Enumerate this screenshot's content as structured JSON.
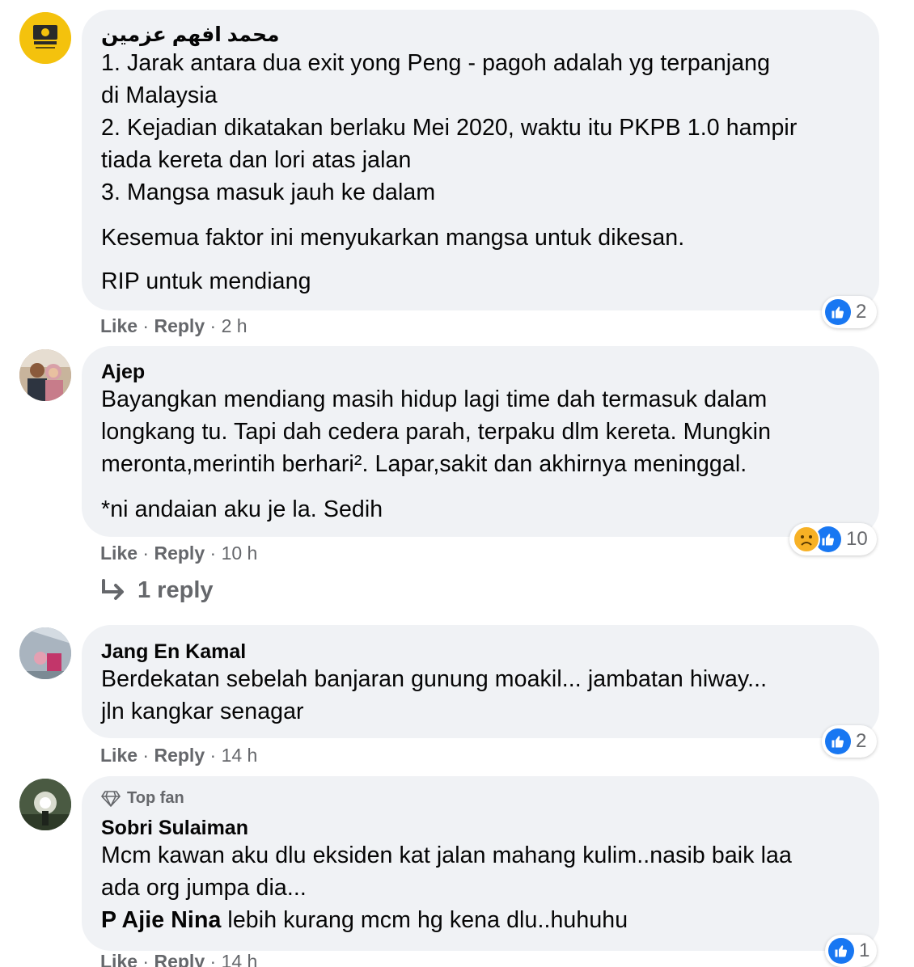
{
  "comments": [
    {
      "author": "محمد افهم عزمين",
      "lines": [
        "1. Jarak antara dua exit yong Peng - pagoh adalah yg terpanjang",
        "di Malaysia",
        "2. Kejadian dikatakan berlaku Mei 2020, waktu itu PKPB 1.0 hampir",
        "tiada kereta dan lori atas jalan",
        "3. Mangsa masuk jauh ke dalam",
        "Kesemua faktor ini menyukarkan mangsa untuk dikesan.",
        "RIP untuk mendiang"
      ],
      "like_label": "Like",
      "reply_label": "Reply",
      "time": "2 h",
      "reaction_count": "2"
    },
    {
      "author": "Ajep",
      "lines": [
        "Bayangkan mendiang masih hidup lagi time dah termasuk dalam",
        "longkang tu. Tapi dah cedera parah, terpaku dlm kereta. Mungkin",
        "meronta,merintih berhari². Lapar,sakit dan akhirnya meninggal.",
        "*ni andaian aku je la. Sedih"
      ],
      "like_label": "Like",
      "reply_label": "Reply",
      "time": "10 h",
      "reaction_count": "10",
      "replies_label": "1 reply"
    },
    {
      "author": "Jang En Kamal",
      "lines": [
        "Berdekatan sebelah banjaran gunung moakil... jambatan hiway...",
        "jln kangkar senagar"
      ],
      "like_label": "Like",
      "reply_label": "Reply",
      "time": "14 h",
      "reaction_count": "2"
    },
    {
      "badge": "Top fan",
      "author": "Sobri Sulaiman",
      "lines": [
        "Mcm kawan aku dlu eksiden kat jalan mahang kulim..nasib baik laa",
        "ada org jumpa dia..."
      ],
      "mention": "P Ajie Nina",
      "mention_text": " lebih kurang mcm hg kena dlu..huhuhu",
      "like_label": "Like",
      "reply_label": "Reply",
      "time": "14 h",
      "reaction_count": "1"
    }
  ],
  "separator": "·",
  "colors": {
    "bubble": "#f0f2f5",
    "meta": "#65676b",
    "like_blue": "#1877f2",
    "text": "#050505"
  },
  "icons": {
    "like": "thumbs-up-icon",
    "sad": "sad-face-icon",
    "reply_arrow": "reply-arrow-icon",
    "top_fan": "diamond-icon"
  }
}
